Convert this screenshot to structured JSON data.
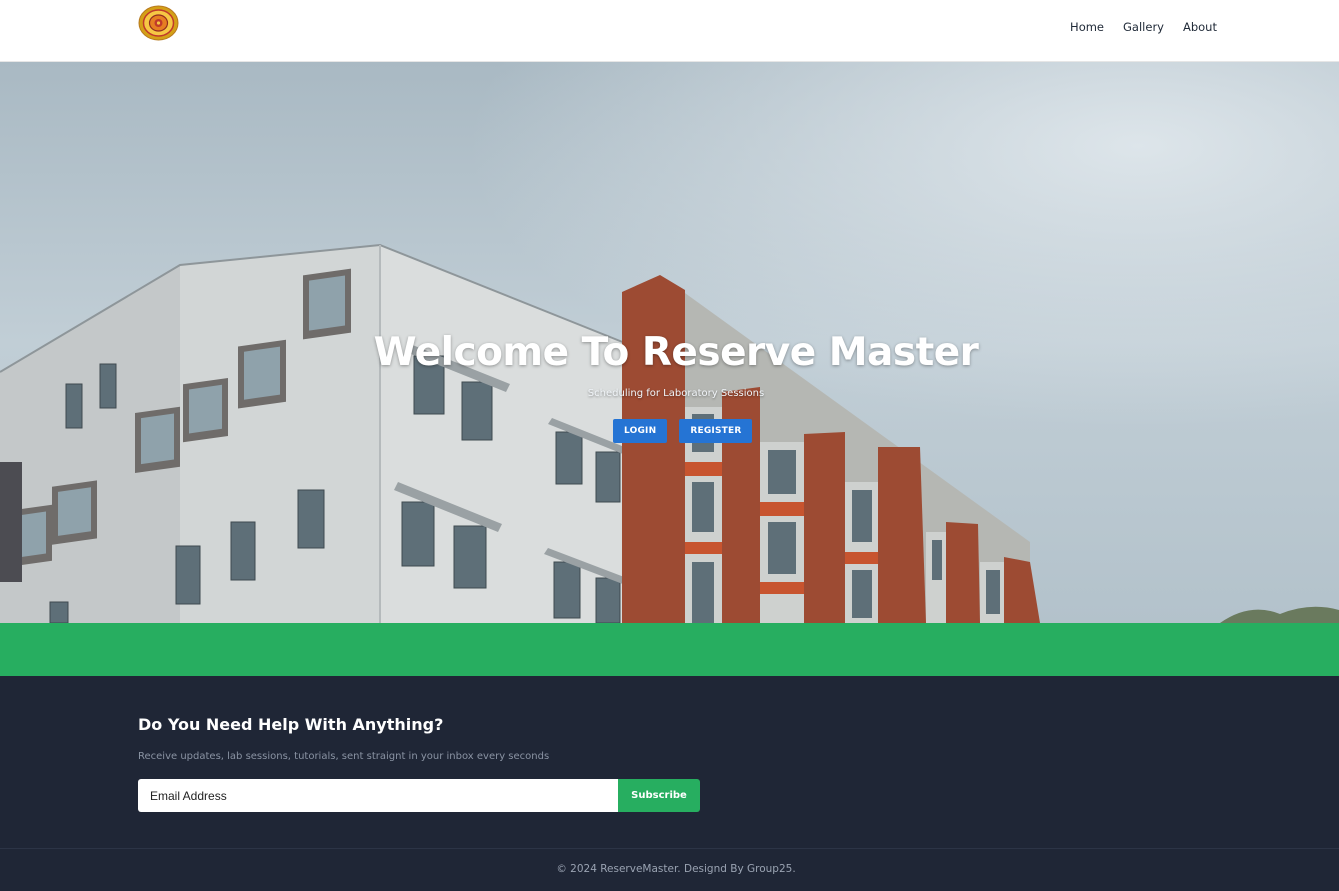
{
  "header": {
    "logo_icon": "university-seal-icon",
    "nav": [
      "Home",
      "Gallery",
      "About"
    ]
  },
  "hero": {
    "title": "Welcome To Reserve Master",
    "subtitle": "Scheduling for Laboratory Sessions",
    "login_label": "LOGIN",
    "register_label": "REGISTER"
  },
  "newsletter": {
    "title": "Do You Need Help With Anything?",
    "text": "Receive updates, lab sessions, tutorials, sent straignt in your inbox every seconds",
    "email_placeholder": "Email Address",
    "subscribe_label": "Subscribe"
  },
  "footer": {
    "copyright": "© 2024 ReserveMaster. Designd By Group25."
  },
  "colors": {
    "accent_blue": "#2574d4",
    "accent_green": "#27ae60",
    "footer_bg": "#1f2636"
  }
}
